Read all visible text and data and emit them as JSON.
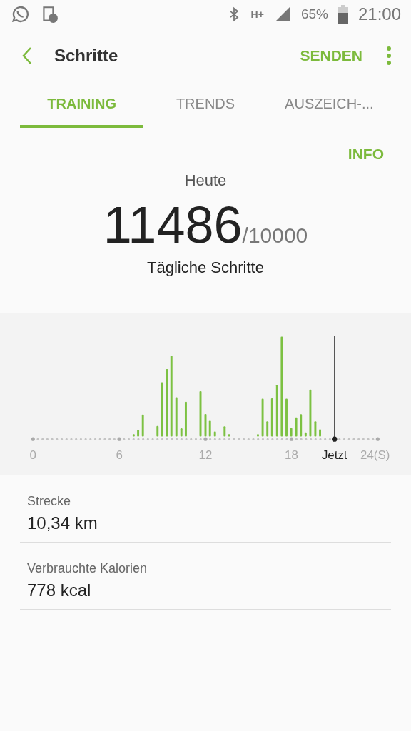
{
  "status_bar": {
    "network": "H+",
    "battery": "65%",
    "time": "21:00"
  },
  "app_bar": {
    "title": "Schritte",
    "action": "SENDEN"
  },
  "tabs": [
    {
      "label": "TRAINING",
      "selected": true
    },
    {
      "label": "TRENDS",
      "selected": false
    },
    {
      "label": "AUSZEICH-...",
      "selected": false
    }
  ],
  "info_link": "INFO",
  "summary": {
    "period": "Heute",
    "steps": "11486",
    "goal": "/10000",
    "caption": "Tägliche Schritte"
  },
  "chart": {
    "x_labels": [
      "0",
      "6",
      "12",
      "18",
      "24(S)"
    ],
    "now_label": "Jetzt"
  },
  "stats": [
    {
      "label": "Strecke",
      "value": "10,34 km"
    },
    {
      "label": "Verbrauchte Kalorien",
      "value": "778 kcal"
    }
  ]
}
